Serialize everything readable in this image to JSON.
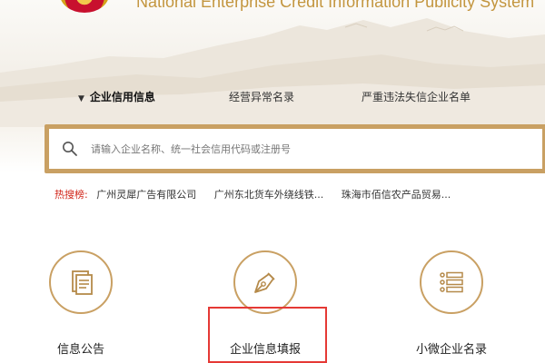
{
  "header": {
    "site_title": "National Enterprise Credit Information Publicity System"
  },
  "nav": {
    "items": [
      {
        "label": "企业信用信息",
        "active": true
      },
      {
        "label": "经营异常名录",
        "active": false
      },
      {
        "label": "严重违法失信企业名单",
        "active": false
      }
    ]
  },
  "search": {
    "placeholder": "请输入企业名称、统一社会信用代码或注册号"
  },
  "hot_search": {
    "label": "热搜榜:",
    "items": [
      "广州灵犀广告有限公司",
      "广州东北货车外绕线铁...",
      "珠海市佰信农产品贸易..."
    ]
  },
  "features": [
    {
      "label": "信息公告",
      "icon": "document-icon"
    },
    {
      "label": "企业信息填报",
      "icon": "pen-nib-icon"
    },
    {
      "label": "小微企业名录",
      "icon": "list-icon"
    }
  ],
  "colors": {
    "gold": "#c9a063",
    "title_gold": "#c3963f",
    "hot_red": "#d1261a",
    "highlight_red": "#e53935"
  }
}
